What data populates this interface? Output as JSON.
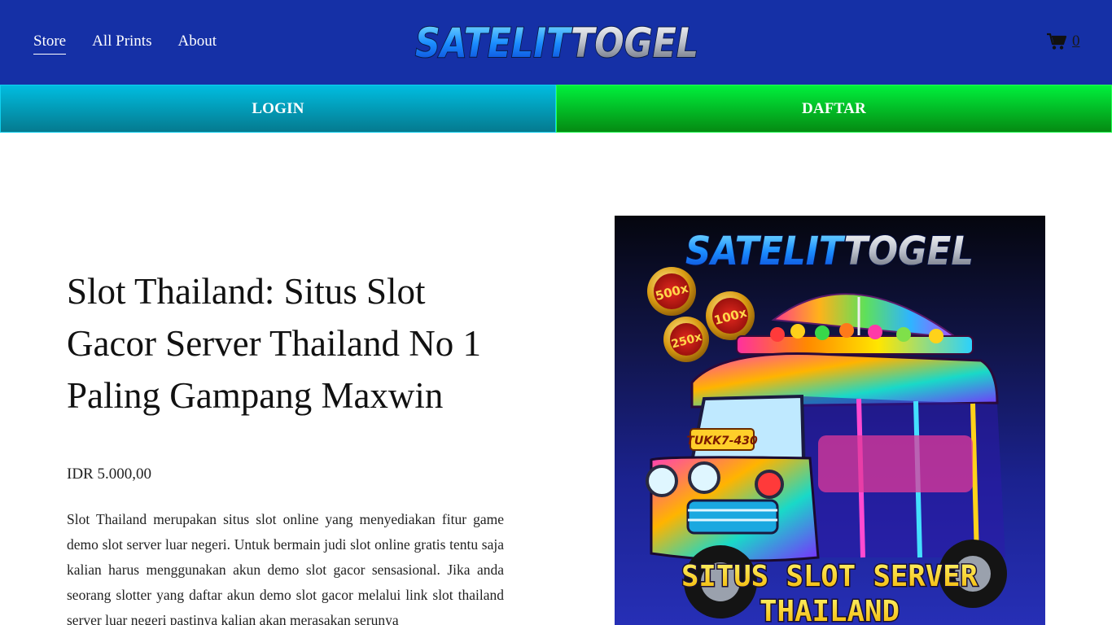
{
  "header": {
    "nav": [
      {
        "label": "Store",
        "active": true
      },
      {
        "label": "All Prints",
        "active": false
      },
      {
        "label": "About",
        "active": false
      }
    ],
    "logo_text": "SATELITTOGEL",
    "cart_count": "0",
    "cart_icon": "shopping-cart-icon"
  },
  "auth": {
    "login_label": "LOGIN",
    "daftar_label": "DAFTAR"
  },
  "product": {
    "title": "Slot Thailand: Situs Slot Gacor Server Thailand No 1 Paling Gampang Maxwin",
    "price": "IDR 5.000,00",
    "description": "Slot Thailand merupakan situs slot online yang menyediakan fitur game demo slot server luar negeri. Untuk bermain judi slot online gratis tentu saja kalian harus menggunakan akun demo slot gacor sensasional. Jika anda seorang slotter yang daftar akun demo slot gacor melalui link slot thailand server luar negeri pastinya kalian akan merasakan serunya",
    "image": {
      "logo_text": "SATELITTOGEL",
      "badges": [
        "500x",
        "100x",
        "250x"
      ],
      "plate_text": "TUKK7-430",
      "caption_line1": "SITUS SLOT SERVER",
      "caption_line2": "THAILAND"
    }
  },
  "colors": {
    "header_bg": "#1530a6",
    "login_bg": "#00a9c9",
    "daftar_bg": "#00d52e"
  }
}
